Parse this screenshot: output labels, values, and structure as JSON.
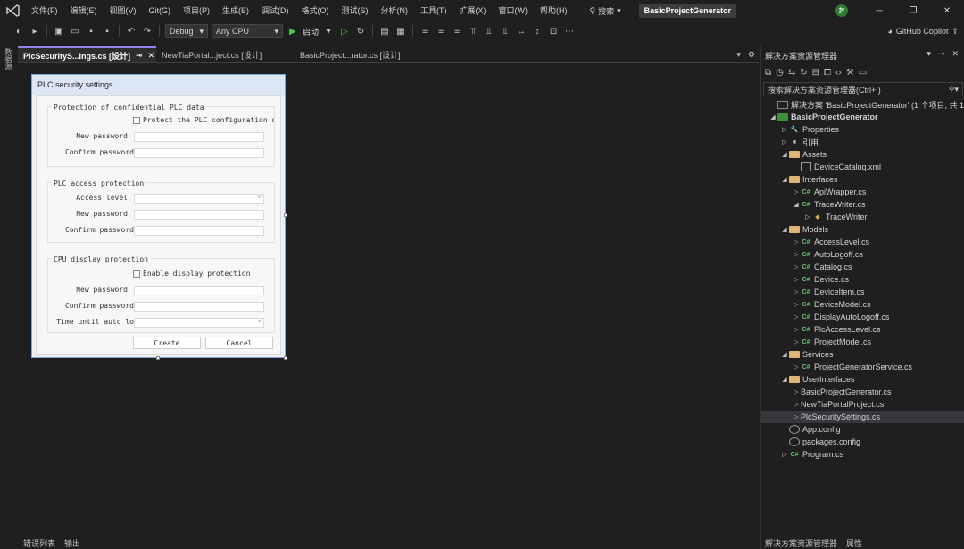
{
  "menubar": {
    "items": [
      "文件(F)",
      "编辑(E)",
      "视图(V)",
      "Git(G)",
      "项目(P)",
      "生成(B)",
      "调试(D)",
      "格式(O)",
      "测试(S)",
      "分析(N)",
      "工具(T)",
      "扩展(X)",
      "窗口(W)",
      "帮助(H)"
    ],
    "search_label": "搜索",
    "project_title": "BasicProjectGenerator",
    "avatar": "梦"
  },
  "toolbar": {
    "config": "Debug",
    "platform": "Any CPU",
    "start_label": "启动",
    "copilot_label": "GitHub Copilot"
  },
  "left_strip": {
    "label": "数据源"
  },
  "tabs": [
    {
      "label": "PlcSecurityS...ings.cs [设计]",
      "active": true
    },
    {
      "label": "NewTiaPortal...ject.cs [设计]",
      "active": false
    },
    {
      "label": "BasicProject...rator.cs [设计]",
      "active": false
    }
  ],
  "form": {
    "title": "PLC security settings",
    "group1": {
      "title": "Protection of confidential PLC data",
      "checkbox": "Protect the PLC configuration da",
      "new_password": "New password",
      "confirm_password": "Confirm password"
    },
    "group2": {
      "title": "PLC access protection",
      "access_level": "Access level",
      "new_password": "New password",
      "confirm_password": "Confirm password"
    },
    "group3": {
      "title": "CPU display protection",
      "checkbox": "Enable display protection",
      "new_password": "New password",
      "confirm_password": "Confirm password",
      "time_until": "Time until auto lo"
    },
    "create_button": "Create",
    "cancel_button": "Cancel"
  },
  "bottom_panel": {
    "tabs": [
      "错误列表",
      "输出"
    ]
  },
  "solution_explorer": {
    "title": "解决方案资源管理器",
    "search_placeholder": "搜索解决方案资源管理器(Ctrl+;)",
    "items": [
      {
        "label": "解决方案 'BasicProjectGenerator' (1 个项目, 共 1",
        "icon": "solution-icon",
        "depth": 0,
        "expander": ""
      },
      {
        "label": "BasicProjectGenerator",
        "icon": "project-icon",
        "depth": 0,
        "expander": "▲",
        "bold": true
      },
      {
        "label": "Properties",
        "icon": "wrench-icon",
        "depth": 1,
        "expander": "▷"
      },
      {
        "label": "引用",
        "icon": "reference-icon",
        "depth": 1,
        "expander": "▷"
      },
      {
        "label": "Assets",
        "icon": "folder-icon",
        "depth": 1,
        "expander": "▲"
      },
      {
        "label": "DeviceCatalog.xml",
        "icon": "xml-file-icon",
        "depth": 2,
        "expander": ""
      },
      {
        "label": "Interfaces",
        "icon": "folder-icon",
        "depth": 1,
        "expander": "▲"
      },
      {
        "label": "ApiWrapper.cs",
        "icon": "csharp-file-icon",
        "depth": 2,
        "expander": "▷"
      },
      {
        "label": "TraceWriter.cs",
        "icon": "csharp-file-icon",
        "depth": 2,
        "expander": "▲"
      },
      {
        "label": "TraceWriter",
        "icon": "class-icon",
        "depth": 3,
        "expander": "▷"
      },
      {
        "label": "Models",
        "icon": "folder-icon",
        "depth": 1,
        "expander": "▲"
      },
      {
        "label": "AccessLevel.cs",
        "icon": "csharp-file-icon",
        "depth": 2,
        "expander": "▷"
      },
      {
        "label": "AutoLogoff.cs",
        "icon": "csharp-file-icon",
        "depth": 2,
        "expander": "▷"
      },
      {
        "label": "Catalog.cs",
        "icon": "csharp-file-icon",
        "depth": 2,
        "expander": "▷"
      },
      {
        "label": "Device.cs",
        "icon": "csharp-file-icon",
        "depth": 2,
        "expander": "▷"
      },
      {
        "label": "DeviceItem.cs",
        "icon": "csharp-file-icon",
        "depth": 2,
        "expander": "▷"
      },
      {
        "label": "DeviceModel.cs",
        "icon": "csharp-file-icon",
        "depth": 2,
        "expander": "▷"
      },
      {
        "label": "DisplayAutoLogoff.cs",
        "icon": "csharp-file-icon",
        "depth": 2,
        "expander": "▷"
      },
      {
        "label": "PlcAccessLevel.cs",
        "icon": "csharp-file-icon",
        "depth": 2,
        "expander": "▷"
      },
      {
        "label": "ProjectModel.cs",
        "icon": "csharp-file-icon",
        "depth": 2,
        "expander": "▷"
      },
      {
        "label": "Services",
        "icon": "folder-icon",
        "depth": 1,
        "expander": "▲"
      },
      {
        "label": "ProjectGeneratorService.cs",
        "icon": "csharp-file-icon",
        "depth": 2,
        "expander": "▷"
      },
      {
        "label": "UserInterfaces",
        "icon": "folder-icon",
        "depth": 1,
        "expander": "▲"
      },
      {
        "label": "BasicProjectGenerator.cs",
        "icon": "form-file-icon",
        "depth": 2,
        "expander": "▷"
      },
      {
        "label": "NewTiaPortalProject.cs",
        "icon": "form-file-icon",
        "depth": 2,
        "expander": "▷"
      },
      {
        "label": "PlcSecuritySettings.cs",
        "icon": "form-file-icon",
        "depth": 2,
        "expander": "▷",
        "selected": true
      },
      {
        "label": "App.config",
        "icon": "config-file-icon",
        "depth": 1,
        "expander": ""
      },
      {
        "label": "packages.config",
        "icon": "config-file-icon",
        "depth": 1,
        "expander": ""
      },
      {
        "label": "Program.cs",
        "icon": "csharp-file-icon",
        "depth": 1,
        "expander": "▷"
      }
    ],
    "bottom_tabs": [
      "解决方案资源管理器",
      "属性"
    ]
  },
  "colors": {
    "accent": "#9184ee",
    "background": "#1f1f1f",
    "editor": "#1e1e1e",
    "folder": "#dcb67a",
    "csharp": "#6fbf73"
  }
}
